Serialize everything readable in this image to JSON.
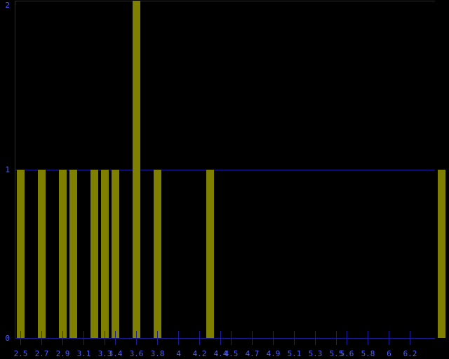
{
  "chart_data": {
    "type": "bar",
    "title": "",
    "xlabel": "",
    "ylabel": "",
    "xlim": [
      2.5,
      6.5
    ],
    "ylim": [
      0,
      2
    ],
    "bin_width": 0.1,
    "x": [
      2.5,
      2.7,
      2.9,
      3.0,
      3.2,
      3.3,
      3.4,
      3.6,
      3.8,
      4.3,
      6.5
    ],
    "values": [
      1,
      1,
      1,
      1,
      1,
      1,
      1,
      2,
      1,
      1,
      1
    ],
    "y_ticks": [
      "0",
      "1",
      "2"
    ],
    "x_tick_values": [
      2.5,
      2.7,
      2.9,
      3.1,
      3.3,
      3.4,
      3.6,
      3.8,
      4.0,
      4.2,
      4.4,
      4.5,
      4.7,
      4.9,
      5.1,
      5.3,
      5.5,
      5.6,
      5.8,
      6.0,
      6.2
    ],
    "x_tick_labels": [
      "2.5",
      "2.7",
      "2.9",
      "3.1",
      "3.3",
      "3.4",
      "3.6",
      "3.8",
      "4",
      "4.2",
      "4.4",
      "4.5",
      "4.7",
      "4.9",
      "5.1",
      "5.3",
      "5.5",
      "5.6",
      "5.8",
      "6",
      "6.2"
    ],
    "grid": "horizontal",
    "colors": {
      "background": "#000000",
      "bar": "#808000",
      "axis": "#1c1c9c",
      "text": "#4a5cff"
    }
  }
}
